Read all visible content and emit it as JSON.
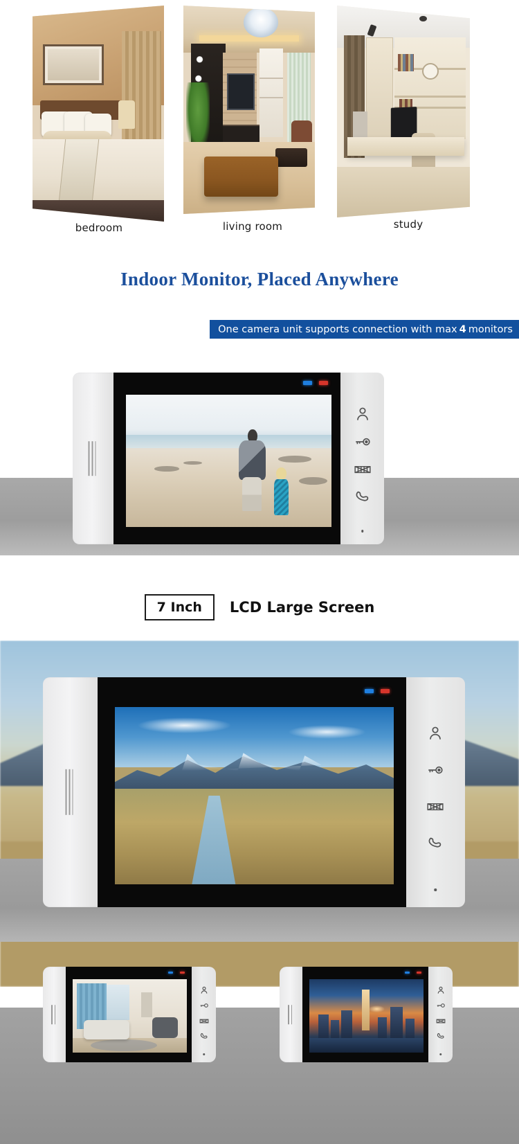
{
  "rooms": {
    "items": [
      {
        "caption": "bedroom",
        "icon": "bedroom-photo"
      },
      {
        "caption": "living room",
        "icon": "living-room-photo"
      },
      {
        "caption": "study",
        "icon": "study-photo"
      }
    ]
  },
  "headline": "Indoor Monitor,  Placed Anywhere",
  "banner": {
    "text_before": "One camera unit supports connection with max",
    "number": "4",
    "text_after": "monitors",
    "background_color": "#12509e",
    "text_color": "#ffffff"
  },
  "feature": {
    "badge": "7 Inch",
    "label": "LCD Large Screen"
  },
  "monitor": {
    "buttons": [
      {
        "name": "visitor-monitor-button",
        "icon": "person-icon"
      },
      {
        "name": "unlock-button",
        "icon": "key-icon"
      },
      {
        "name": "gate-button",
        "icon": "gate-icon"
      },
      {
        "name": "talk-button",
        "icon": "handset-icon"
      }
    ],
    "leds": [
      {
        "name": "power-led",
        "color": "#1f7fe0"
      },
      {
        "name": "status-led",
        "color": "#d6352b"
      }
    ],
    "microphone": "mic-dot",
    "speaker": "speaker-grille"
  },
  "screens": {
    "beach": "beach-scene",
    "mountain": "mountain-river-scene",
    "room": "living-room-scene",
    "city": "city-skyline-scene"
  },
  "colors": {
    "headline": "#1b4f9c",
    "banner": "#12509e",
    "band_gray": "#9d9d9d"
  }
}
